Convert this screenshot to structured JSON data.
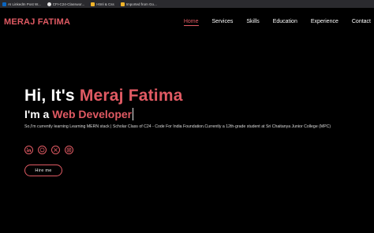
{
  "bookmarks": [
    {
      "label": "AI LinkedIn Post W...",
      "icon": "linkedin-icon",
      "color": "#0a66c2"
    },
    {
      "label": "CFI-C24-Classwor...",
      "icon": "github-icon",
      "color": "#e6e6e6"
    },
    {
      "label": "Html & Css",
      "icon": "folder-icon",
      "color": "#f0b429"
    },
    {
      "label": "Imported from Go...",
      "icon": "folder-icon",
      "color": "#f0b429"
    }
  ],
  "nav": {
    "logo": "MERAJ FATIMA",
    "items": [
      "Home",
      "Services",
      "Skills",
      "Education",
      "Experience",
      "Contact"
    ],
    "active": "Home"
  },
  "hero": {
    "greeting": "Hi, It's ",
    "name": "Meraj Fatima",
    "role_prefix": "I'm a ",
    "role": "Web Developer",
    "description": "So,I'm currently learning Learning MERN stack | Scholar Class of C24 - Code For India Foundation.Currently a 12th-grade student at Sri Chaitanya Junior College (MPC)",
    "socials": [
      "linkedin-icon",
      "github-icon",
      "x-icon",
      "instagram-icon"
    ],
    "cta": "Hire me"
  },
  "colors": {
    "accent": "#e05a63",
    "background": "#000000"
  }
}
